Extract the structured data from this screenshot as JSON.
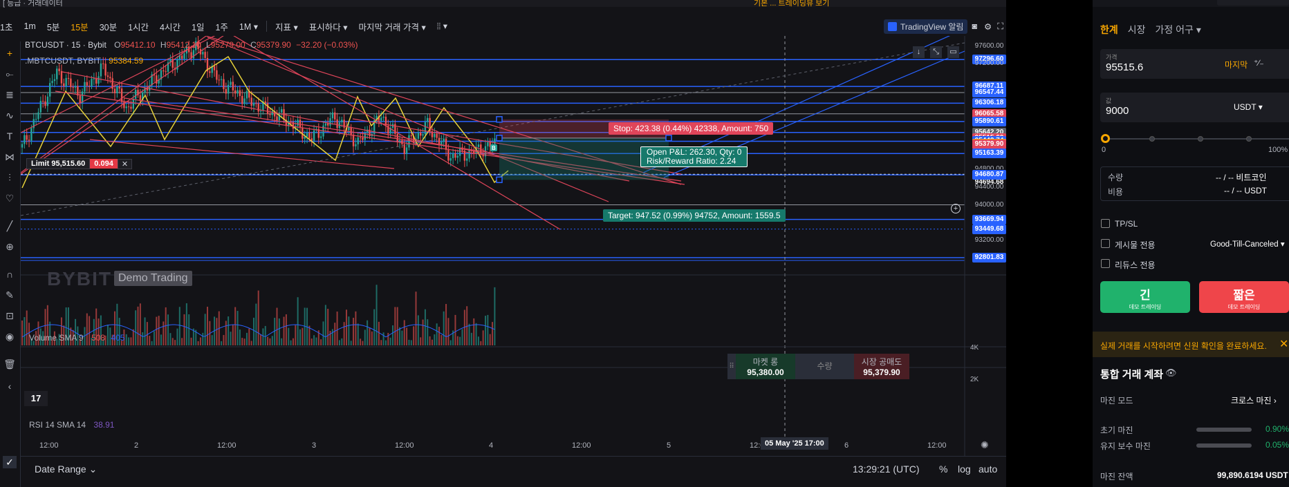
{
  "topbar": {
    "left_text": "[ 등급 · 거래데이터",
    "right_text": "기본 ... 트레이딩뷰 보기"
  },
  "toolbar": {
    "timeframes": [
      "1초",
      "1m",
      "5분",
      "15분",
      "30분",
      "1시간",
      "4시간",
      "1일",
      "1주",
      "1M ▾"
    ],
    "active_timeframe": "15분",
    "indicators": "지표 ▾",
    "display": "표시하다 ▾",
    "last_price": "마지막 거래 가격 ▾",
    "chart_type": "⦙⦙ ▾",
    "tv_alert": "TradingView 알림"
  },
  "chart": {
    "symbol": "BTCUSDT · 15 · Bybit",
    "ohlc": {
      "o_label": "O",
      "o": "95412.10",
      "h_label": "H",
      "h": "95412.10",
      "l_label": "L",
      "l": "95279.00",
      "c_label": "C",
      "c": "95379.90",
      "change": "−32.20 (−0.03%)"
    },
    "index_symbol": ".MBTCUSDT, BYBIT",
    "index_value": "95384.59",
    "watermark": "BYBIT",
    "demo_badge": "Demo Trading",
    "limit_label": "Limit 95,515.60",
    "limit_qty": "0.094",
    "limit_close": "✕",
    "stop_label": "Stop: 423.38 (0.44%) 42338, Amount: 750",
    "pnl_line1": "Open P&L: 262.30, Qty: 0",
    "pnl_line2": "Risk/Reward Ratio: 2.24",
    "target_label": "Target: 947.52 (0.99%) 94752, Amount: 1559.5",
    "volume_label": "Volume SMA 9",
    "volume_v1": "508",
    "volume_v2": "405",
    "rsi_label": "RSI 14 SMA 14",
    "rsi_value": "38.91",
    "volume_axis": [
      "4K",
      "2K"
    ]
  },
  "price_axis": [
    {
      "text": "97600.00",
      "kind": "plain"
    },
    {
      "text": "97296.60",
      "kind": "blue"
    },
    {
      "text": "97200.00",
      "kind": "plain"
    },
    {
      "text": "96687.11",
      "kind": "blue"
    },
    {
      "text": "96547.44",
      "kind": "blue"
    },
    {
      "text": "96306.18",
      "kind": "blue"
    },
    {
      "text": "96065.58",
      "kind": "red"
    },
    {
      "text": "95890.61",
      "kind": "blue"
    },
    {
      "text": "95642.20",
      "kind": "gray"
    },
    {
      "text": "95515.60",
      "kind": "red"
    },
    {
      "text": "95442.74",
      "kind": "blue"
    },
    {
      "text": "95384.59",
      "kind": "orange"
    },
    {
      "text": "95379.90",
      "kind": "red"
    },
    {
      "text": "95163.39",
      "kind": "blue"
    },
    {
      "text": "94800.00",
      "kind": "plain"
    },
    {
      "text": "94694.68",
      "kind": "dark"
    },
    {
      "text": "94694.68",
      "kind": "dark"
    },
    {
      "text": "94680.87",
      "kind": "blue"
    },
    {
      "text": "94400.00",
      "kind": "plain"
    },
    {
      "text": "94000.00",
      "kind": "plain"
    },
    {
      "text": "93669.94",
      "kind": "blue"
    },
    {
      "text": "93449.68",
      "kind": "blue"
    },
    {
      "text": "93200.00",
      "kind": "plain"
    },
    {
      "text": "92801.83",
      "kind": "blue"
    }
  ],
  "time_axis": [
    "12:00",
    "2",
    "12:00",
    "3",
    "12:00",
    "4",
    "12:00",
    "5",
    "12:00",
    "6",
    "12:00"
  ],
  "time_highlight": "05 May '25   17:00",
  "quick_trade": {
    "buy_label": "마켓 롱",
    "buy_price": "95,380.00",
    "qty_label": "수량",
    "sell_label": "시장 공매도",
    "sell_price": "95,379.90"
  },
  "bottombar": {
    "date_range": "Date Range ⌄",
    "clock": "13:29:21 (UTC)",
    "pct": "%",
    "log": "log",
    "auto": "auto"
  },
  "order_panel": {
    "tabs": [
      "한계",
      "시장",
      "가정 어구 ▾"
    ],
    "price_label": "가격",
    "price_value": "95515.6",
    "price_last": "마지막",
    "qty_label": "값",
    "qty_value": "9000",
    "qty_unit": "USDT ▾",
    "slider_min": "0",
    "slider_max": "100%",
    "qty_row_label": "수량",
    "qty_row_value": "-- / -- 비트코인",
    "cost_row_label": "비용",
    "cost_row_value": "-- / -- USDT",
    "tpsl": "TP/SL",
    "post_only": "게시물 전용",
    "tif": "Good-Till-Canceled ▾",
    "reduce_only": "리듀스 전용",
    "long_btn": "긴",
    "long_sub": "데모 트레이딩",
    "short_btn": "짧은",
    "short_sub": "데모 트레이딩",
    "warning": "실제 거래를 시작하려면 신원 확인을 완료하세요.",
    "account_title": "통합 거래 계좌",
    "margin_mode_label": "마진 모드",
    "margin_mode_value": "크로스 마진 ›",
    "initial_margin_label": "초기 마진",
    "initial_margin_value": "0.90%",
    "maint_margin_label": "유지 보수 마진",
    "maint_margin_value": "0.05%",
    "balance_label": "마진 잔액",
    "balance_value": "99,890.6194 USDT"
  },
  "colors": {
    "accent": "#f7a600",
    "blue_line": "#2962ff",
    "red_line": "#e0455a",
    "yellow_zigzag": "#e8d23a",
    "up": "#26a69a",
    "down": "#ef5350",
    "long_btn": "#20b26c",
    "short_btn": "#ef454a"
  },
  "left_tools": [
    "crosshair-icon",
    "horizontal-line-icon",
    "fib-icon",
    "trend-icon",
    "text-icon",
    "pattern-icon",
    "forecast-icon",
    "heart-icon",
    "ruler-icon",
    "zoom-icon",
    "magnet-icon",
    "lock-drawing-icon",
    "lock-icon",
    "eye-icon",
    "trash-icon"
  ]
}
